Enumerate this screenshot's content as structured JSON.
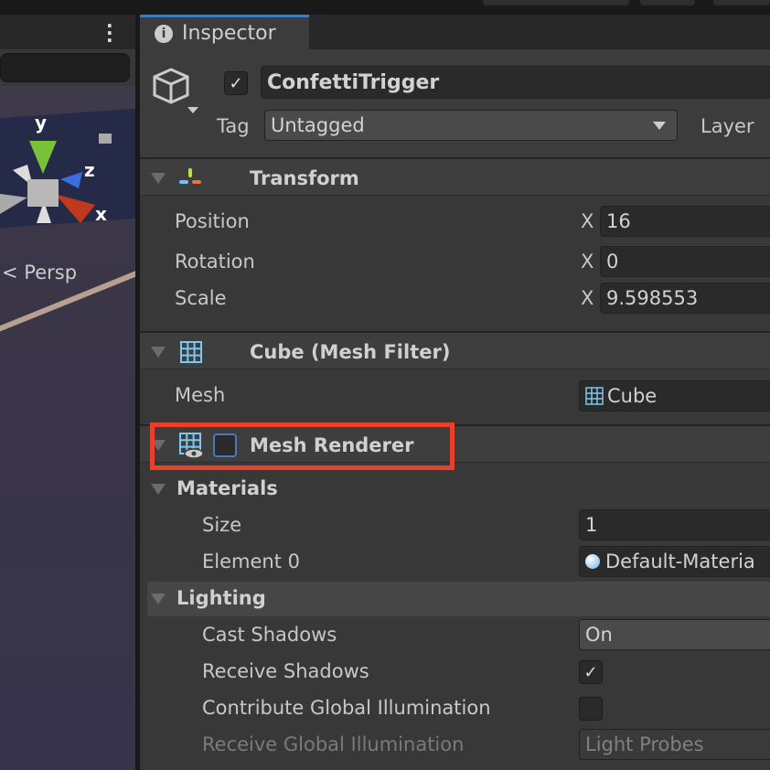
{
  "scene": {
    "axes": {
      "y": "y",
      "z": "z",
      "x": "x"
    },
    "persp_label": "Persp"
  },
  "inspector": {
    "tab_label": "Inspector",
    "object": {
      "active": true,
      "name": "ConfettiTrigger",
      "tag_label": "Tag",
      "tag_value": "Untagged",
      "layer_label": "Layer"
    },
    "transform": {
      "title": "Transform",
      "rows": [
        {
          "label": "Position",
          "axis": "X",
          "value": "16"
        },
        {
          "label": "Rotation",
          "axis": "X",
          "value": "0"
        },
        {
          "label": "Scale",
          "axis": "X",
          "value": "9.598553"
        }
      ]
    },
    "mesh_filter": {
      "title": "Cube (Mesh Filter)",
      "mesh_label": "Mesh",
      "mesh_value": "Cube"
    },
    "mesh_renderer": {
      "title": "Mesh Renderer",
      "enabled": false,
      "highlight_color": "#e8402a"
    },
    "materials": {
      "title": "Materials",
      "size_label": "Size",
      "size_value": "1",
      "element_label": "Element 0",
      "element_value": "Default-Materia"
    },
    "lighting": {
      "title": "Lighting",
      "cast_label": "Cast Shadows",
      "cast_value": "On",
      "receive_label": "Receive Shadows",
      "receive_checked": true,
      "contrib_label": "Contribute Global Illumination",
      "contrib_checked": false,
      "receive_gi_label": "Receive Global Illumination",
      "receive_gi_value": "Light Probes"
    }
  }
}
